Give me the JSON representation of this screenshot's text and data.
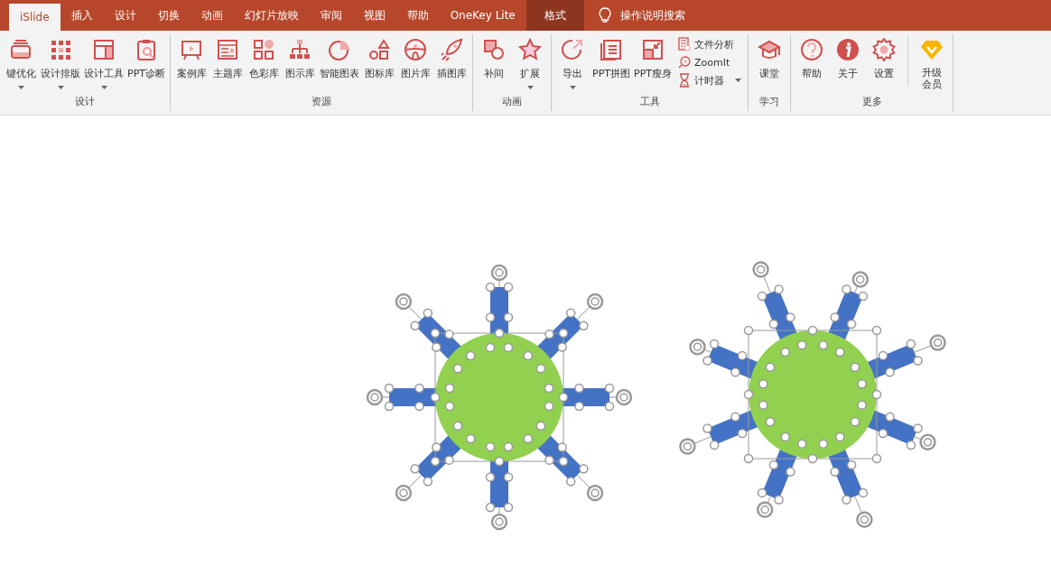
{
  "tabs": [
    {
      "label": "iSlide",
      "selected": true,
      "kind": "normal"
    },
    {
      "label": "插入",
      "selected": false,
      "kind": "normal"
    },
    {
      "label": "设计",
      "selected": false,
      "kind": "normal"
    },
    {
      "label": "切换",
      "selected": false,
      "kind": "normal"
    },
    {
      "label": "动画",
      "selected": false,
      "kind": "normal"
    },
    {
      "label": "幻灯片放映",
      "selected": false,
      "kind": "normal"
    },
    {
      "label": "审阅",
      "selected": false,
      "kind": "normal"
    },
    {
      "label": "视图",
      "selected": false,
      "kind": "normal"
    },
    {
      "label": "帮助",
      "selected": false,
      "kind": "normal"
    },
    {
      "label": "OneKey Lite",
      "selected": false,
      "kind": "normal"
    },
    {
      "label": "格式",
      "selected": false,
      "kind": "contextual"
    }
  ],
  "search": {
    "placeholder": "操作说明搜索"
  },
  "groups": [
    {
      "label": "设计",
      "buttons": [
        {
          "label": "键优化",
          "dropdown": true,
          "kind": "normal"
        },
        {
          "label": "设计排版",
          "dropdown": true,
          "kind": "normal"
        },
        {
          "label": "设计工具",
          "dropdown": true,
          "kind": "normal"
        },
        {
          "label": "PPT诊断",
          "dropdown": false,
          "kind": "normal"
        }
      ]
    },
    {
      "label": "资源",
      "buttons": [
        {
          "label": "案例库",
          "dropdown": false,
          "kind": "normal"
        },
        {
          "label": "主题库",
          "dropdown": false,
          "kind": "normal"
        },
        {
          "label": "色彩库",
          "dropdown": false,
          "kind": "normal"
        },
        {
          "label": "图示库",
          "dropdown": false,
          "kind": "normal"
        },
        {
          "label": "智能图表",
          "dropdown": false,
          "kind": "normal"
        },
        {
          "label": "图标库",
          "dropdown": false,
          "kind": "normal"
        },
        {
          "label": "图片库",
          "dropdown": false,
          "kind": "normal"
        },
        {
          "label": "插图库",
          "dropdown": false,
          "kind": "normal"
        }
      ]
    },
    {
      "label": "动画",
      "buttons": [
        {
          "label": "补间",
          "dropdown": false,
          "kind": "normal"
        },
        {
          "label": "扩展",
          "dropdown": true,
          "kind": "normal"
        }
      ]
    },
    {
      "label": "工具",
      "buttons": [
        {
          "label": "导出",
          "dropdown": true,
          "kind": "normal"
        },
        {
          "label": "PPT拼图",
          "dropdown": false,
          "kind": "normal"
        },
        {
          "label": "PPT瘦身",
          "dropdown": false,
          "kind": "normal"
        }
      ],
      "small_buttons": [
        {
          "label": "文件分析",
          "dropdown": false
        },
        {
          "label": "ZoomIt",
          "dropdown": false
        },
        {
          "label": "计时器",
          "dropdown": true
        }
      ]
    },
    {
      "label": "学习",
      "buttons": [
        {
          "label": "课堂",
          "dropdown": false,
          "kind": "normal"
        }
      ]
    },
    {
      "label": "更多",
      "buttons": [
        {
          "label": "帮助",
          "dropdown": false,
          "kind": "normal"
        },
        {
          "label": "关于",
          "dropdown": false,
          "kind": "normal"
        },
        {
          "label": "设置",
          "dropdown": false,
          "kind": "normal"
        },
        {
          "label": "升级会员",
          "dropdown": false,
          "kind": "promo"
        }
      ]
    }
  ]
}
